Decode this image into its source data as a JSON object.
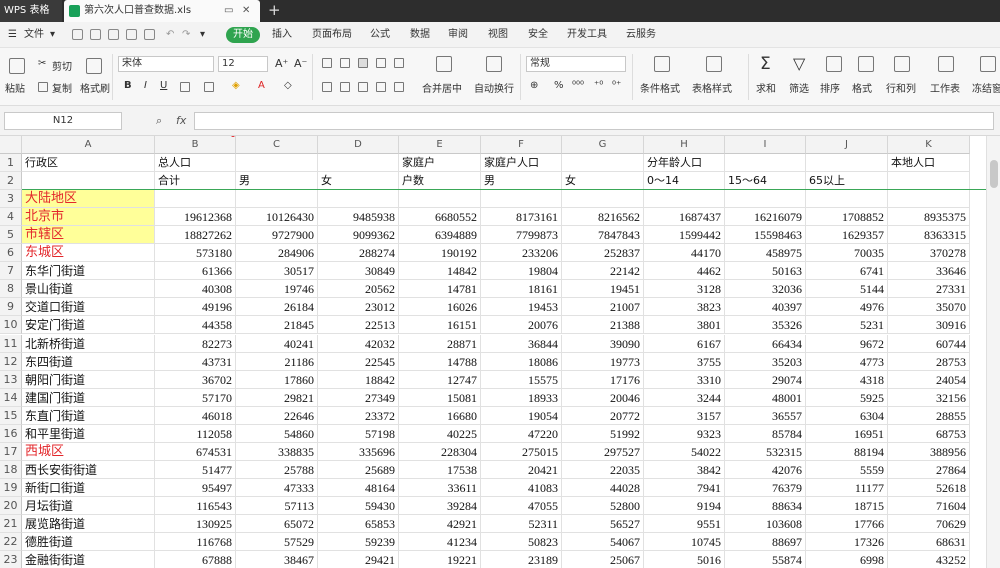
{
  "titlebar": {
    "app_name": "WPS 表格",
    "doc_name": "第六次人口普查数据.xls",
    "new_tab": "+"
  },
  "menu": {
    "file": "文件",
    "start": "开始",
    "items": [
      "插入",
      "页面布局",
      "公式",
      "数据",
      "审阅",
      "视图",
      "安全",
      "开发工具",
      "云服务"
    ]
  },
  "ribbon": {
    "paste": "粘贴",
    "cut": "剪切",
    "copy": "复制",
    "format_painter": "格式刷",
    "font_name": "宋体",
    "font_size": "12",
    "merge_center": "合并居中",
    "wrap_text": "自动换行",
    "number_format": "常规",
    "conditional_format": "条件格式",
    "table_style": "表格样式",
    "sum": "求和",
    "filter": "筛选",
    "sort": "排序",
    "format": "格式",
    "rows_cols": "行和列",
    "worksheet": "工作表",
    "freeze": "冻结窗"
  },
  "formula_bar": {
    "cell_ref": "N12",
    "fx": "fx",
    "value": ""
  },
  "sheet": {
    "columns": [
      "A",
      "B",
      "C",
      "D",
      "E",
      "F",
      "G",
      "H",
      "I",
      "J",
      "K"
    ],
    "header_row1": [
      "行政区",
      "总人口",
      "",
      "",
      "家庭户",
      "家庭户人口",
      "",
      "分年龄人口",
      "",
      "",
      "本地人口"
    ],
    "header_row2": [
      "",
      "合计",
      "男",
      "女",
      "户数",
      "男",
      "女",
      "0～14",
      "15～64",
      "65以上",
      ""
    ],
    "rows": [
      {
        "num": "3",
        "name": "大陆地区",
        "style": "hl",
        "values": [
          "",
          "",
          "",
          "",
          "",
          "",
          "",
          "",
          "",
          ""
        ]
      },
      {
        "num": "4",
        "name": "北京市",
        "style": "hl",
        "values": [
          "19612368",
          "10126430",
          "9485938",
          "6680552",
          "8173161",
          "8216562",
          "1687437",
          "16216079",
          "1708852",
          "8935375"
        ]
      },
      {
        "num": "5",
        "name": "市辖区",
        "style": "hl",
        "values": [
          "18827262",
          "9727900",
          "9099362",
          "6394889",
          "7799873",
          "7847843",
          "1599442",
          "15598463",
          "1629357",
          "8363315"
        ]
      },
      {
        "num": "6",
        "name": "东城区",
        "style": "red",
        "values": [
          "573180",
          "284906",
          "288274",
          "190192",
          "233206",
          "252837",
          "44170",
          "458975",
          "70035",
          "370278"
        ]
      },
      {
        "num": "7",
        "name": "东华门街道",
        "style": "",
        "values": [
          "61366",
          "30517",
          "30849",
          "14842",
          "19804",
          "22142",
          "4462",
          "50163",
          "6741",
          "33646"
        ]
      },
      {
        "num": "8",
        "name": "景山街道",
        "style": "",
        "values": [
          "40308",
          "19746",
          "20562",
          "14781",
          "18161",
          "19451",
          "3128",
          "32036",
          "5144",
          "27331"
        ]
      },
      {
        "num": "9",
        "name": "交道口街道",
        "style": "",
        "values": [
          "49196",
          "26184",
          "23012",
          "16026",
          "19453",
          "21007",
          "3823",
          "40397",
          "4976",
          "35070"
        ]
      },
      {
        "num": "10",
        "name": "安定门街道",
        "style": "",
        "values": [
          "44358",
          "21845",
          "22513",
          "16151",
          "20076",
          "21388",
          "3801",
          "35326",
          "5231",
          "30916"
        ]
      },
      {
        "num": "11",
        "name": "北新桥街道",
        "style": "",
        "values": [
          "82273",
          "40241",
          "42032",
          "28871",
          "36844",
          "39090",
          "6167",
          "66434",
          "9672",
          "60744"
        ]
      },
      {
        "num": "12",
        "name": "东四街道",
        "style": "",
        "values": [
          "43731",
          "21186",
          "22545",
          "14788",
          "18086",
          "19773",
          "3755",
          "35203",
          "4773",
          "28753"
        ]
      },
      {
        "num": "13",
        "name": "朝阳门街道",
        "style": "",
        "values": [
          "36702",
          "17860",
          "18842",
          "12747",
          "15575",
          "17176",
          "3310",
          "29074",
          "4318",
          "24054"
        ]
      },
      {
        "num": "14",
        "name": "建国门街道",
        "style": "",
        "values": [
          "57170",
          "29821",
          "27349",
          "15081",
          "18933",
          "20046",
          "3244",
          "48001",
          "5925",
          "32156"
        ]
      },
      {
        "num": "15",
        "name": "东直门街道",
        "style": "",
        "values": [
          "46018",
          "22646",
          "23372",
          "16680",
          "19054",
          "20772",
          "3157",
          "36557",
          "6304",
          "28855"
        ]
      },
      {
        "num": "16",
        "name": "和平里街道",
        "style": "",
        "values": [
          "112058",
          "54860",
          "57198",
          "40225",
          "47220",
          "51992",
          "9323",
          "85784",
          "16951",
          "68753"
        ]
      },
      {
        "num": "17",
        "name": "西城区",
        "style": "red",
        "values": [
          "674531",
          "338835",
          "335696",
          "228304",
          "275015",
          "297527",
          "54022",
          "532315",
          "88194",
          "388956"
        ]
      },
      {
        "num": "18",
        "name": "西长安街街道",
        "style": "",
        "values": [
          "51477",
          "25788",
          "25689",
          "17538",
          "20421",
          "22035",
          "3842",
          "42076",
          "5559",
          "27864"
        ]
      },
      {
        "num": "19",
        "name": "新街口街道",
        "style": "",
        "values": [
          "95497",
          "47333",
          "48164",
          "33611",
          "41083",
          "44028",
          "7941",
          "76379",
          "11177",
          "52618"
        ]
      },
      {
        "num": "20",
        "name": "月坛街道",
        "style": "",
        "values": [
          "116543",
          "57113",
          "59430",
          "39284",
          "47055",
          "52800",
          "9194",
          "88634",
          "18715",
          "71604"
        ]
      },
      {
        "num": "21",
        "name": "展览路街道",
        "style": "",
        "values": [
          "130925",
          "65072",
          "65853",
          "42921",
          "52311",
          "56527",
          "9551",
          "103608",
          "17766",
          "70629"
        ]
      },
      {
        "num": "22",
        "name": "德胜街道",
        "style": "",
        "values": [
          "116768",
          "57529",
          "59239",
          "41234",
          "50823",
          "54067",
          "10745",
          "88697",
          "17326",
          "68631"
        ]
      },
      {
        "num": "23",
        "name": "金融街街道",
        "style": "",
        "values": [
          "67888",
          "38467",
          "29421",
          "19221",
          "23189",
          "25067",
          "5016",
          "55874",
          "6998",
          "43252"
        ]
      }
    ]
  }
}
